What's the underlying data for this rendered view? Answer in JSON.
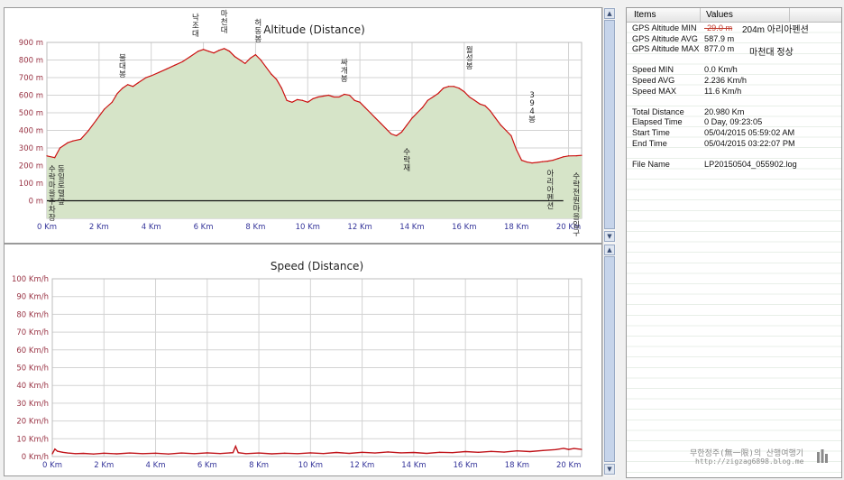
{
  "altitude_chart": {
    "chart_data": {
      "type": "area",
      "title": "Altitude (Distance)",
      "x_ticks": [
        "0 Km",
        "2 Km",
        "4 Km",
        "6 Km",
        "8 Km",
        "10 Km",
        "12 Km",
        "14 Km",
        "16 Km",
        "18 Km",
        "20 Km"
      ],
      "y_ticks": [
        "0 m",
        "100 m",
        "200 m",
        "300 m",
        "400 m",
        "500 m",
        "600 m",
        "700 m",
        "800 m",
        "900 m"
      ],
      "xlim": [
        0,
        20.5
      ],
      "ylim": [
        -100,
        900
      ],
      "grid": true,
      "x": [
        0,
        0.3,
        0.5,
        0.8,
        1.0,
        1.3,
        1.6,
        1.9,
        2.2,
        2.5,
        2.7,
        2.9,
        3.1,
        3.3,
        3.5,
        3.8,
        4.0,
        4.3,
        4.6,
        4.9,
        5.2,
        5.5,
        5.8,
        6.0,
        6.2,
        6.4,
        6.6,
        6.8,
        7.0,
        7.2,
        7.4,
        7.6,
        7.8,
        8.0,
        8.2,
        8.4,
        8.6,
        8.8,
        9.0,
        9.2,
        9.4,
        9.6,
        9.8,
        10.0,
        10.2,
        10.4,
        10.6,
        10.8,
        11.0,
        11.2,
        11.4,
        11.6,
        11.8,
        12.0,
        12.2,
        12.4,
        12.6,
        12.8,
        13.0,
        13.2,
        13.4,
        13.6,
        13.8,
        14.0,
        14.2,
        14.4,
        14.6,
        14.8,
        15.0,
        15.2,
        15.4,
        15.6,
        15.8,
        16.0,
        16.2,
        16.4,
        16.6,
        16.8,
        17.0,
        17.2,
        17.4,
        17.6,
        17.8,
        18.0,
        18.2,
        18.4,
        18.6,
        18.8,
        19.0,
        19.2,
        19.4,
        19.6,
        19.8,
        20.0,
        20.3,
        20.5
      ],
      "y": [
        255,
        245,
        300,
        330,
        340,
        350,
        400,
        460,
        520,
        560,
        610,
        640,
        660,
        650,
        670,
        700,
        710,
        730,
        750,
        770,
        790,
        820,
        850,
        860,
        850,
        840,
        855,
        865,
        850,
        820,
        800,
        780,
        810,
        830,
        800,
        760,
        720,
        690,
        640,
        570,
        560,
        575,
        570,
        560,
        580,
        590,
        595,
        600,
        590,
        590,
        605,
        600,
        570,
        560,
        530,
        500,
        470,
        440,
        410,
        380,
        370,
        390,
        430,
        470,
        500,
        530,
        570,
        590,
        610,
        640,
        650,
        650,
        640,
        620,
        590,
        570,
        550,
        540,
        510,
        470,
        430,
        400,
        370,
        290,
        230,
        220,
        215,
        218,
        222,
        225,
        230,
        240,
        250,
        255,
        256,
        258
      ],
      "annotations": [
        {
          "x": 0.2,
          "text": "수락마을주차장"
        },
        {
          "x": 0.55,
          "text": "동일로텔앞"
        },
        {
          "x": 2.9,
          "text": "불대봉"
        },
        {
          "x": 5.7,
          "text": "낙조대"
        },
        {
          "x": 6.8,
          "text": "마천대"
        },
        {
          "x": 8.1,
          "text": "허동봉"
        },
        {
          "x": 11.4,
          "text": "싸개봉"
        },
        {
          "x": 13.8,
          "text": "수락재"
        },
        {
          "x": 16.2,
          "text": "월성봉"
        },
        {
          "x": 18.6,
          "text": "394봉"
        },
        {
          "x": 19.3,
          "text": "아리아펜션"
        },
        {
          "x": 20.3,
          "text": "수락전원마을입구"
        }
      ]
    }
  },
  "speed_chart": {
    "chart_data": {
      "type": "line",
      "title": "Speed (Distance)",
      "x_ticks": [
        "0 Km",
        "2 Km",
        "4 Km",
        "6 Km",
        "8 Km",
        "10 Km",
        "12 Km",
        "14 Km",
        "16 Km",
        "18 Km",
        "20 Km"
      ],
      "y_ticks": [
        "0 Km/h",
        "10 Km/h",
        "20 Km/h",
        "30 Km/h",
        "40 Km/h",
        "50 Km/h",
        "60 Km/h",
        "70 Km/h",
        "80 Km/h",
        "90 Km/h",
        "100 Km/h"
      ],
      "xlim": [
        0,
        20.5
      ],
      "ylim": [
        0,
        100
      ],
      "grid": true,
      "x": [
        0,
        0.1,
        0.2,
        0.4,
        0.6,
        0.9,
        1.2,
        1.6,
        2.0,
        2.5,
        3.0,
        3.5,
        4.0,
        4.5,
        5.0,
        5.5,
        6.0,
        6.5,
        7.0,
        7.1,
        7.2,
        7.3,
        7.5,
        8.0,
        8.5,
        9.0,
        9.5,
        10.0,
        10.5,
        11.0,
        11.5,
        12.0,
        12.5,
        13.0,
        13.5,
        14.0,
        14.5,
        15.0,
        15.5,
        16.0,
        16.5,
        17.0,
        17.5,
        18.0,
        18.5,
        19.0,
        19.5,
        19.8,
        20.0,
        20.2,
        20.5
      ],
      "y": [
        1.5,
        4.2,
        3.0,
        2.4,
        2.0,
        1.6,
        1.8,
        1.4,
        1.9,
        1.5,
        2.0,
        1.6,
        1.9,
        1.4,
        2.0,
        1.6,
        2.1,
        1.7,
        2.2,
        5.8,
        2.2,
        2.0,
        1.6,
        2.0,
        1.5,
        1.9,
        1.6,
        2.1,
        1.7,
        2.3,
        1.8,
        2.4,
        2.0,
        2.6,
        2.1,
        2.3,
        1.8,
        2.4,
        2.2,
        2.8,
        2.4,
        2.9,
        2.5,
        3.2,
        2.8,
        3.4,
        3.9,
        4.6,
        4.0,
        4.5,
        4.0
      ],
      "annotations": []
    }
  },
  "info": {
    "header": {
      "items": "Items",
      "values": "Values"
    },
    "rows": [
      {
        "key": "GPS Altitude MIN",
        "value": "-29.0 m",
        "note": "204m 아리아펜션"
      },
      {
        "key": "GPS Altitude AVG",
        "value": "587.9 m",
        "note": ""
      },
      {
        "key": "GPS Altitude MAX",
        "value": "877.0 m",
        "note": "마천대 정상"
      },
      {
        "key": "",
        "value": "",
        "note": ""
      },
      {
        "key": "Speed MIN",
        "value": "0.0 Km/h",
        "note": ""
      },
      {
        "key": "Speed AVG",
        "value": "2.236 Km/h",
        "note": ""
      },
      {
        "key": "Speed MAX",
        "value": "11.6 Km/h",
        "note": ""
      },
      {
        "key": "",
        "value": "",
        "note": ""
      },
      {
        "key": "Total Distance",
        "value": "20.980 Km",
        "note": ""
      },
      {
        "key": "Elapsed Time",
        "value": "0 Day, 09:23:05",
        "note": ""
      },
      {
        "key": "Start Time",
        "value": "05/04/2015 05:59:02 AM",
        "note": ""
      },
      {
        "key": "End Time",
        "value": "05/04/2015 03:22:07 PM",
        "note": ""
      },
      {
        "key": "",
        "value": "",
        "note": ""
      },
      {
        "key": "File Name",
        "value": "LP20150504_055902.log",
        "note": ""
      }
    ],
    "watermark_line1": "무한정주(無一限)의 산행여행기",
    "watermark_line2": "http://zigzag6898.blog.me"
  },
  "colors": {
    "area_fill": "#d6e4c8",
    "altitude_line": "#cc1111",
    "speed_line": "#c0141a",
    "grid": "#d3d3d3",
    "tick_label": "#333399",
    "axis_label": "#993344",
    "info_strike": "#c0392b"
  }
}
